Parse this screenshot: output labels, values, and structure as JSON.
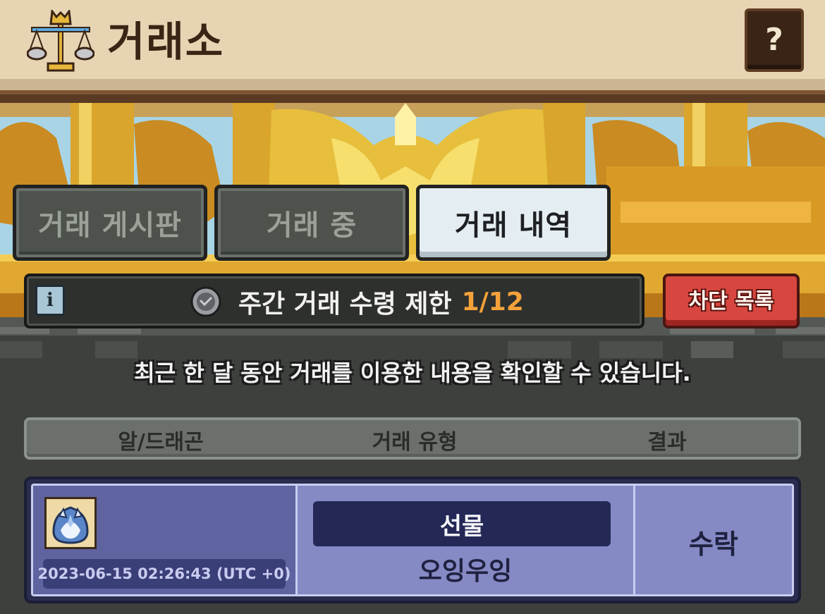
{
  "header": {
    "title": "거래소",
    "logo_icon": "scales-icon",
    "help_label": "?"
  },
  "tabs": [
    {
      "label": "거래 게시판",
      "active": false
    },
    {
      "label": "거래 중",
      "active": false
    },
    {
      "label": "거래 내역",
      "active": true
    }
  ],
  "limit_bar": {
    "info_icon": "info-icon",
    "medal_icon": "medal-icon",
    "text": "주간 거래 수령 제한",
    "count": "1/12",
    "count_color": "#f4a23a"
  },
  "block_list_label": "차단 목록",
  "description": "최근 한 달 동안 거래를 이용한 내용을 확인할 수 있습니다.",
  "table": {
    "headers": [
      "알/드래곤",
      "거래 유형",
      "결과"
    ],
    "rows": [
      {
        "item_icon": "egg-icon",
        "timestamp": "2023-06-15 02:26:43 (UTC +0)",
        "trade_type": "선물",
        "partner": "오잉우잉",
        "result": "수락"
      }
    ]
  }
}
